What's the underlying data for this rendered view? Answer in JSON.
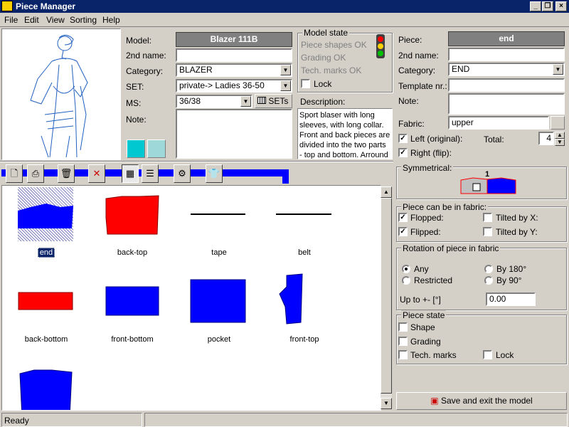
{
  "window": {
    "title": "Piece Manager"
  },
  "menu": [
    "File",
    "Edit",
    "View",
    "Sorting",
    "Help"
  ],
  "model": {
    "model_label": "Model:",
    "model_value": "Blazer 111B",
    "second_name_label": "2nd name:",
    "second_name_value": "",
    "category_label": "Category:",
    "category_value": "BLAZER",
    "set_label": "SET:",
    "set_value": "private-> Ladies 36-50",
    "ms_label": "MS:",
    "ms_value": "36/38",
    "sets_button": "SETs",
    "note_label": "Note:",
    "note_value": ""
  },
  "model_state": {
    "title": "Model state",
    "items": [
      "Piece shapes OK",
      "Grading OK",
      "Tech. marks OK"
    ],
    "lock_label": "Lock",
    "description_label": "Description:",
    "description": "Sport blaser with long sleeves, with long collar. Front and back pieces are divided into the two parts - top and bottom. Arround"
  },
  "piece": {
    "piece_label": "Piece:",
    "piece_value": "end",
    "second_name_label": "2nd name:",
    "second_name_value": "",
    "category_label": "Category:",
    "category_value": "END",
    "template_label": "Template nr.:",
    "template_value": "",
    "note_label": "Note:",
    "note_value": "",
    "fabric_label": "Fabric:",
    "fabric_value": "upper",
    "left_label": "Left (original):",
    "right_label": "Right (flip):",
    "total_label": "Total:",
    "total_value": "4"
  },
  "symmetrical": {
    "title": "Symmetrical:",
    "number": "1"
  },
  "fabric_opts": {
    "title": "Piece can be in fabric:",
    "flopped": "Flopped:",
    "flipped": "Flipped:",
    "tilted_x": "Tilted by X:",
    "tilted_y": "Tilted by Y:"
  },
  "rotation": {
    "title": "Rotation of piece in fabric",
    "any": "Any",
    "restricted": "Restricted",
    "by180": "By 180°",
    "by90": "By 90°",
    "upto_label": "Up to +- [°]",
    "upto_value": "0.00"
  },
  "piece_state": {
    "title": "Piece state",
    "shape": "Shape",
    "grading": "Grading",
    "tech": "Tech. marks",
    "lock": "Lock"
  },
  "save_button": "Save and exit the model",
  "pieces": [
    {
      "name": "end",
      "color": "#0000ff"
    },
    {
      "name": "back-top",
      "color": "#ff0000"
    },
    {
      "name": "tape",
      "color": "#000000"
    },
    {
      "name": "belt",
      "color": "#000000"
    },
    {
      "name": "back-bottom",
      "color": "#ff0000"
    },
    {
      "name": "front-bottom",
      "color": "#0000ff"
    },
    {
      "name": "pocket",
      "color": "#0000ff"
    },
    {
      "name": "front-top",
      "color": "#0000ff"
    },
    {
      "name": "",
      "color": "#0000ff"
    }
  ],
  "status": {
    "text": "Ready"
  }
}
